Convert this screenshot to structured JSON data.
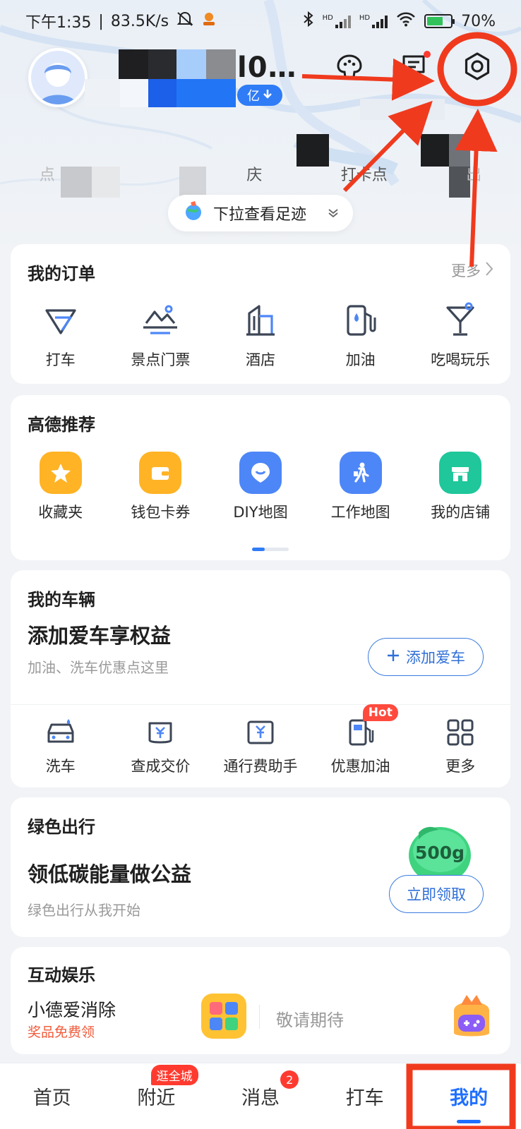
{
  "status_bar": {
    "time": "下午1:35",
    "net_speed": "83.5K/s",
    "hd1": "HD",
    "hd2": "HD",
    "battery": "70%",
    "battery_level": 0.7
  },
  "profile": {
    "username_visible": "l0…",
    "level_suffix": "亿",
    "stats": [
      "点",
      "庆",
      "打卡点",
      "出"
    ]
  },
  "footprint": {
    "label": "下拉查看足迹"
  },
  "orders": {
    "title": "我的订单",
    "more": "更多",
    "items": [
      {
        "label": "打车",
        "icon": "taxi-icon"
      },
      {
        "label": "景点门票",
        "icon": "scenic-ticket-icon"
      },
      {
        "label": "酒店",
        "icon": "hotel-icon"
      },
      {
        "label": "加油",
        "icon": "fuel-icon"
      },
      {
        "label": "吃喝玩乐",
        "icon": "cocktail-icon"
      }
    ]
  },
  "recommend": {
    "title": "高德推荐",
    "items": [
      {
        "label": "收藏夹",
        "icon": "star-icon",
        "color": "#ffb325"
      },
      {
        "label": "钱包卡券",
        "icon": "wallet-icon",
        "color": "#ffb325"
      },
      {
        "label": "DIY地图",
        "icon": "diy-map-icon",
        "color": "#4d86f7"
      },
      {
        "label": "工作地图",
        "icon": "walker-icon",
        "color": "#4d86f7"
      },
      {
        "label": "我的店铺",
        "icon": "shop-icon",
        "color": "#1fc79b"
      }
    ]
  },
  "vehicle": {
    "title": "我的车辆",
    "headline": "添加爱车享权益",
    "sub": "加油、洗车优惠点这里",
    "add_button": "添加爱车",
    "items": [
      {
        "label": "洗车",
        "icon": "car-wash-icon"
      },
      {
        "label": "查成交价",
        "icon": "price-check-icon"
      },
      {
        "label": "通行费助手",
        "icon": "toll-icon"
      },
      {
        "label": "优惠加油",
        "icon": "fuel-discount-icon",
        "badge": "Hot"
      },
      {
        "label": "更多",
        "icon": "grid-icon"
      }
    ]
  },
  "green": {
    "title": "绿色出行",
    "headline": "领低碳能量做公益",
    "sub": "绿色出行从我开始",
    "energy": "500g",
    "button": "立即领取"
  },
  "fun": {
    "title": "互动娱乐",
    "game_title": "小德爱消除",
    "game_sub": "奖品免费领",
    "coming": "敬请期待"
  },
  "nav": {
    "items": [
      {
        "label": "首页"
      },
      {
        "label": "附近",
        "badge": "逛全城"
      },
      {
        "label": "消息",
        "badge": "2"
      },
      {
        "label": "打车"
      },
      {
        "label": "我的"
      }
    ]
  },
  "colors": {
    "accent": "#1f6fff",
    "annotation": "#f03a1e",
    "hot": "#ff4a3d"
  }
}
